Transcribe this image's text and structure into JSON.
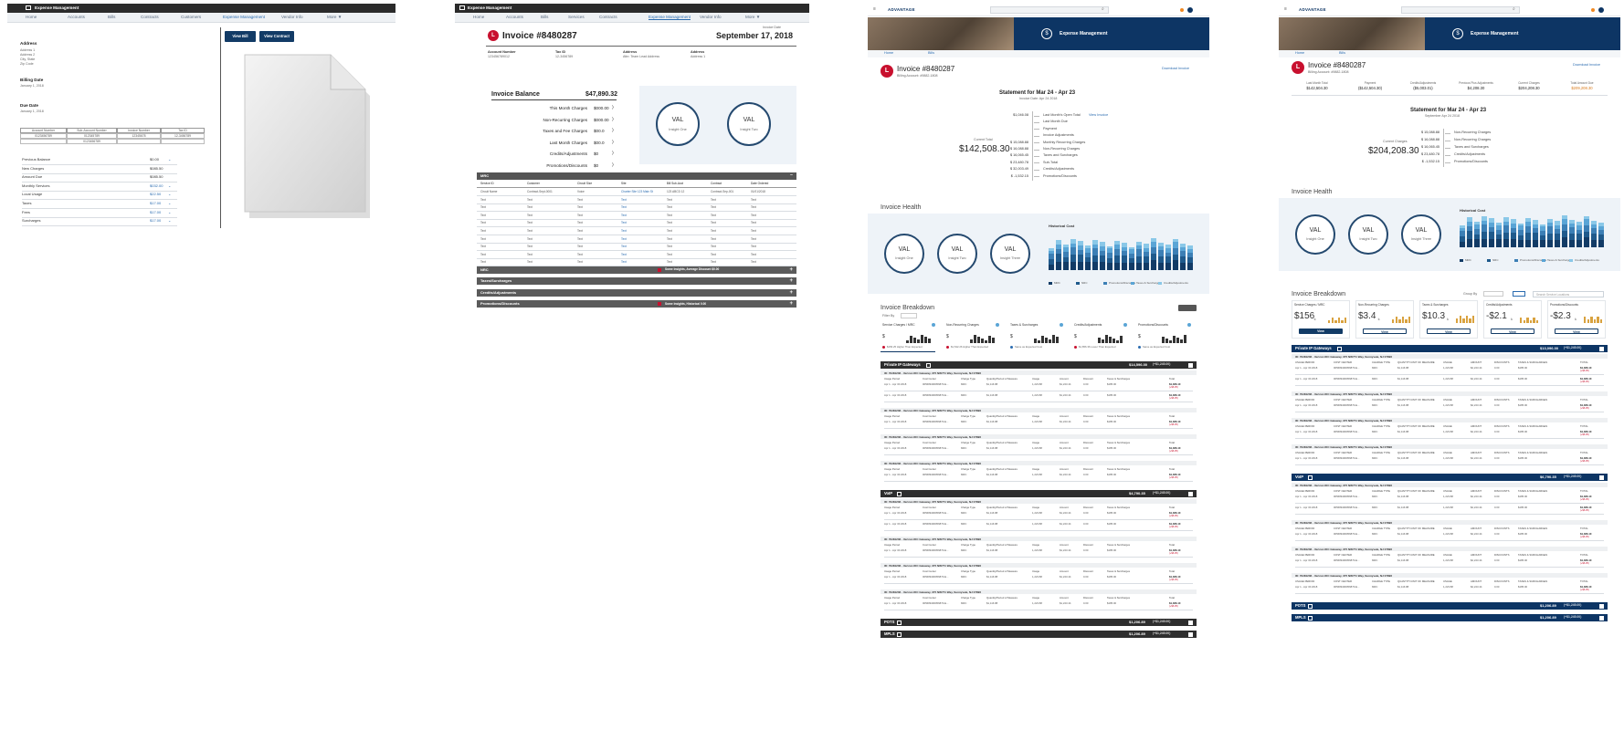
{
  "p1": {
    "app_title": "Expense Management",
    "nav": [
      "Home",
      "Accounts",
      "Bills",
      "Contracts",
      "Customers",
      "Expense Management",
      "Vendor Info",
      "More ▼"
    ],
    "address_label": "Address",
    "address_lines": [
      "Address 1",
      "Address 2",
      "City, State",
      "Zip Code"
    ],
    "billing_date_label": "Billing Date",
    "billing_date": "January 1, 2018",
    "due_date_label": "Due Date",
    "due_date": "January 1, 2018",
    "view_bill": "View Bill",
    "view_contract": "View Contract",
    "table_headers": [
      "Account Number",
      "Sub-Account Number",
      "Invoice Number",
      "Tax ID"
    ],
    "table_rows": [
      [
        "0123456789",
        "012345789",
        "12345678",
        "12-3456789"
      ],
      [
        "",
        "0123456789",
        "",
        ""
      ]
    ],
    "summary": [
      {
        "label": "Previous Balance",
        "value": "$0.00"
      },
      {
        "label": "New Charges",
        "value": "$085.50"
      },
      {
        "label": "Amount Due",
        "value": "$085.50"
      },
      {
        "label": "Monthly Services",
        "value": "$032.00"
      },
      {
        "label": "Local Usage",
        "value": "$22.50"
      },
      {
        "label": "Taxes",
        "value": "$17.00"
      },
      {
        "label": "Fees",
        "value": "$17.00"
      },
      {
        "label": "Surcharges",
        "value": "$17.00"
      }
    ]
  },
  "p2": {
    "app_title": "Expense Management",
    "nav": [
      "Home",
      "Accounts",
      "Bills",
      "Services",
      "Contracts",
      "Expense Management",
      "Vendor Info",
      "More ▼"
    ],
    "invoice_title": "Invoice #8480287",
    "invoice_date": "September 17, 2018",
    "invoice_date_label": "Invoice Date",
    "meta": [
      {
        "label": "Account Number",
        "value": "123456789012"
      },
      {
        "label": "Tax ID",
        "value": "12-3456789"
      },
      {
        "label": "Address",
        "value": "Attn: Team Lead Address"
      },
      {
        "label": "Address",
        "value": "Address 1"
      }
    ],
    "balance_label": "Invoice Balance",
    "balance_value": "$47,890.32",
    "charges": [
      {
        "label": "This Month Charges",
        "value": "$000.00"
      },
      {
        "label": "Non-Recurring Charges",
        "value": "$000.00"
      },
      {
        "label": "Taxes and Fee Charges",
        "value": "$00.0"
      },
      {
        "label": "Last Month Charges",
        "value": "$00.0"
      },
      {
        "label": "Credits/Adjustments",
        "value": "$0"
      },
      {
        "label": "Promotions/Discounts",
        "value": "$0"
      }
    ],
    "circles": [
      {
        "value": "VAL",
        "label": "Insight One"
      },
      {
        "value": "VAL",
        "label": "Insight Two"
      }
    ],
    "mrc_label": "MRC",
    "table_headers": [
      "Service ID",
      "Customer",
      "Circuit Size",
      "Site",
      "Bill Sub-Acct",
      "Contract",
      "Date Ordered"
    ],
    "table_first": [
      "Circuit Name",
      "Contract-Sept-0001",
      "Voice",
      "Charter Site 123 Main St",
      "123 ABCD 12",
      "Contract-Sep-001",
      "01/01/2018"
    ],
    "text_cell": "Text",
    "sections": [
      "NRC",
      "Taxes/Surcharges",
      "Credits/Adjustments",
      "Promotions/Discounts"
    ],
    "section_notes": [
      "Some Insights, Average Discount $0.00",
      "",
      "",
      "Some Insights, Historical 0.00"
    ]
  },
  "p3": {
    "brand": "ADVANTAGE",
    "hero_title": "Expense Management",
    "tabs": [
      "Home",
      "Bills"
    ],
    "invoice_title": "Invoice #8480287",
    "billing_account": "Billing Account: #9882-1808",
    "download": "Download Invoice",
    "statement_title": "Statement for Mar 24 - Apr 23",
    "statement_sub": "Invoice Date: Apr 24 2018",
    "total_label": "Current Total",
    "total_value": "$142,508.30",
    "lines": [
      {
        "value": "$1,046.08",
        "label": "Last Month's Open Total",
        "link": "View Invoice"
      },
      {
        "value": "",
        "label": "Last Month Due"
      },
      {
        "value": "",
        "label": "Payment"
      },
      {
        "value": "",
        "label": "Invoice Adjustments"
      },
      {
        "value": "$ 15,088.88",
        "label": "Monthly Recurring Charges"
      },
      {
        "value": "$ 16,088.88",
        "label": "Non-Recurring Charges"
      },
      {
        "value": "$ 16,065.45",
        "label": "Taxes and Surcharges"
      },
      {
        "value": "$ 23,480.78",
        "label": "Sub-Total"
      },
      {
        "value": "$ 32,003.49",
        "label": "Credits/Adjustments"
      },
      {
        "value": "$ -1,532.15",
        "label": "Promotions/Discounts"
      }
    ],
    "health_title": "Invoice Health",
    "circles": [
      {
        "value": "VAL",
        "label": "Insight One"
      },
      {
        "value": "VAL",
        "label": "Insight Two"
      },
      {
        "value": "VAL",
        "label": "Insight Three"
      }
    ],
    "hist_title": "Historical Cost",
    "legend": [
      "MRC",
      "NRC",
      "Promotions/Discounts",
      "Taxes & Surcharges",
      "Credits/Adjustments"
    ],
    "breakdown_title": "Invoice Breakdown",
    "filter": "Filter By",
    "kpis": [
      {
        "label": "Service Charges / MRC",
        "value": "$",
        "note": "$156.25 Higher Than Expected"
      },
      {
        "label": "Non-Recurring Charges",
        "value": "$",
        "note": "$1,542.26 Higher Than Expected"
      },
      {
        "label": "Taxes & Surcharges",
        "value": "$",
        "note": "Same as Expected Cost"
      },
      {
        "label": "Credits/Adjustments",
        "value": "$",
        "note": "$1,856.36 Lower Than Expected"
      },
      {
        "label": "Promotions/Discounts",
        "value": "$",
        "note": "Same as Expected Cost"
      }
    ],
    "groups": [
      {
        "name": "Private IP Gateways",
        "total": "$14,596.00",
        "sub": "(+$1,245.00)",
        "rows": 4
      },
      {
        "name": "VoIP",
        "total": "$4,790.35",
        "sub": "(+$1,245.00)",
        "rows": 4
      },
      {
        "name": "POTS",
        "total": "$1,206.89",
        "sub": "(+$1,245.00)",
        "rows": 0
      },
      {
        "name": "MPLS",
        "total": "$1,206.89",
        "sub": "(+$1,245.00)",
        "rows": 0
      }
    ],
    "site_line": "ID: 79481236 - Verizon IDC Gateway, 375 NW771 Way, Sunnyvale, NJ 07896",
    "col_headers": [
      "Usage Period",
      "Cost Center",
      "Charge Type",
      "Quantity/Period of Measure",
      "Usage",
      "Amount",
      "Discount",
      "Taxes & Surcharges",
      "Total"
    ],
    "row_values": [
      "Apr 1 - Apr 30 2018",
      "005689490056870-E...",
      "MRC",
      "$1,116.88",
      "1,223.88",
      "$1,223.44",
      "0.00",
      "$185.00",
      "$1,366.10"
    ]
  },
  "p4": {
    "brand": "ADVANTAGE",
    "hero_title": "Expense Management",
    "tabs": [
      "Home",
      "Bills"
    ],
    "invoice_title": "Invoice #8480287",
    "billing_account": "Billing Account: #9882-1808",
    "download": "Download Invoice",
    "summary": [
      {
        "label": "Last Month Total",
        "value": "$142,504.30"
      },
      {
        "label": "Payment",
        "value": "($142,504.30)"
      },
      {
        "label": "Credits/Adjustments",
        "value": "($5,003.01)"
      },
      {
        "label": "Previous Plus Adjustments",
        "value": "$4,208.30"
      },
      {
        "label": "Current Charges",
        "value": "$204,208.30"
      },
      {
        "label": "Total Amount Due",
        "value": "$209,208.30"
      }
    ],
    "statement_title": "Statement for Mar 24 - Apr 23",
    "statement_sub": "September Apr 24 2018",
    "total_label": "Current Charges",
    "total_value": "$204,208.30",
    "lines": [
      {
        "value": "$ 15,088.88",
        "label": "Non-Recurring Charges"
      },
      {
        "value": "$ 16,088.88",
        "label": "Non-Recurring Charges"
      },
      {
        "value": "$ 16,065.45",
        "label": "Taxes and Surcharges"
      },
      {
        "value": "$ 23,480.78",
        "label": "Credits/Adjustments"
      },
      {
        "value": "$ -1,532.15",
        "label": "Promotions/Discounts"
      }
    ],
    "health_title": "Invoice Health",
    "circles": [
      {
        "value": "VAL",
        "label": "Insight One"
      },
      {
        "value": "VAL",
        "label": "Insight Two"
      },
      {
        "value": "VAL",
        "label": "Insight Three"
      }
    ],
    "hist_title": "Historical Cost",
    "legend": [
      "MRC",
      "NRC",
      "Promotions/Discounts",
      "Taxes & Surcharges",
      "Credits/Adjustments"
    ],
    "breakdown_title": "Invoice Breakdown",
    "group_by": "Group By",
    "search_placeholder": "Search Service Locations",
    "kpis": [
      {
        "label": "Service Charges / MRC",
        "value": "$156",
        "unit": "k",
        "btn": "View"
      },
      {
        "label": "Non-Recurring Charges",
        "value": "$3.4",
        "unit": "k",
        "btn": "View"
      },
      {
        "label": "Taxes & Surcharges",
        "value": "$10.3",
        "unit": "k",
        "btn": "View"
      },
      {
        "label": "Credits/Adjustments",
        "value": "-$2.1",
        "unit": "k",
        "btn": "View"
      },
      {
        "label": "Promotions/Discounts",
        "value": "-$2.3",
        "unit": "k",
        "btn": "View"
      }
    ],
    "groups": [
      {
        "name": "Private IP Gateways",
        "total": "$13,096.00",
        "sub": "(+$1,245.00)",
        "rows": 4
      },
      {
        "name": "VoIP",
        "total": "$6,790.35",
        "sub": "(+$1,245.00)",
        "rows": 4
      },
      {
        "name": "POTS",
        "total": "$1,206.89",
        "sub": "(+$1,245.00)",
        "rows": 0
      },
      {
        "name": "MPLS",
        "total": "$1,206.89",
        "sub": "(+$1,245.00)",
        "rows": 0
      }
    ],
    "site_line": "ID: 79481236 - Verizon IDC Gateway, 375 NW771 Way, Sunnyvale, NJ 07896",
    "col_headers": [
      "USAGE PERIOD",
      "COST CENTER",
      "CHARGE TYPE",
      "QUANTITY/UNIT OF MEASURE",
      "USAGE",
      "AMOUNT",
      "DISCOUNTS",
      "TAXES & SURCHARGES",
      "TOTAL"
    ],
    "row_values": [
      "Apr 1 - Apr 30 2018",
      "005689490056870-E...",
      "MRC",
      "$1,116.88",
      "1,223.88",
      "$2,223.44",
      "0.00",
      "$185.00",
      "$1,366.10"
    ]
  }
}
